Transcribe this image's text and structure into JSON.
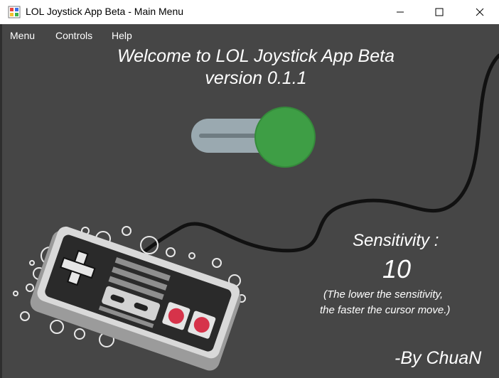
{
  "window": {
    "title": "LOL Joystick App Beta - Main Menu",
    "controls": {
      "minimize": "minimize",
      "maximize": "maximize",
      "close": "close"
    }
  },
  "menu": {
    "items": [
      {
        "label": "Menu"
      },
      {
        "label": "Controls"
      },
      {
        "label": "Help"
      }
    ]
  },
  "main": {
    "welcome_line1": "Welcome to LOL Joystick App Beta",
    "welcome_line2": "version 0.1.1",
    "toggle": {
      "state": "on",
      "knob_color": "#3e9e45",
      "track_color": "#9aa9b0"
    },
    "sensitivity_label": "Sensitivity :",
    "sensitivity_value": "10",
    "note_line1": "(The lower the sensitivity,",
    "note_line2": "the faster the cursor move.)",
    "byline": "-By ChuaN"
  },
  "colors": {
    "background": "#464646",
    "text": "#ffffff",
    "button_red": "#d6334a"
  },
  "icons": [
    "app-icon",
    "minimize-icon",
    "maximize-icon",
    "close-icon",
    "gamepad-illustration"
  ]
}
